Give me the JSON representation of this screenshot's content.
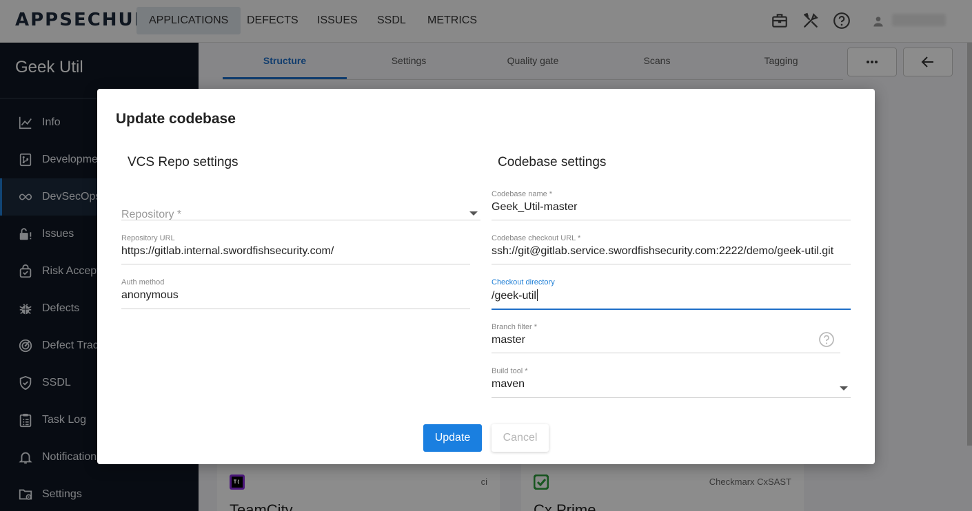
{
  "app": {
    "logo": "APPSECHUB"
  },
  "topnav": {
    "items": [
      {
        "label": "APPLICATIONS",
        "active": true
      },
      {
        "label": "DEFECTS"
      },
      {
        "label": "ISSUES"
      },
      {
        "label": "SSDL"
      },
      {
        "label": "METRICS"
      }
    ],
    "icons": [
      "toolbox-icon",
      "tools-icon",
      "help-icon",
      "user-icon"
    ]
  },
  "sidebar": {
    "title": "Geek Util",
    "items": [
      {
        "label": "Info",
        "icon": "chart-line-icon"
      },
      {
        "label": "Development",
        "icon": "repository-icon"
      },
      {
        "label": "DevSecOps",
        "icon": "infinity-icon",
        "active": true
      },
      {
        "label": "Issues",
        "icon": "lock-alert-icon"
      },
      {
        "label": "Risk Acceptance",
        "icon": "bag-check-icon"
      },
      {
        "label": "Defects",
        "icon": "bug-icon"
      },
      {
        "label": "Defect Tracking",
        "icon": "radar-icon"
      },
      {
        "label": "SSDL",
        "icon": "shield-check-icon"
      },
      {
        "label": "Task Log",
        "icon": "clipboard-list-icon"
      },
      {
        "label": "Notifications",
        "icon": "bell-icon"
      },
      {
        "label": "Settings",
        "icon": "folder-gear-icon"
      }
    ]
  },
  "tabs": [
    {
      "label": "Structure",
      "active": true
    },
    {
      "label": "Settings"
    },
    {
      "label": "Quality gate"
    },
    {
      "label": "Scans"
    },
    {
      "label": "Tagging"
    }
  ],
  "toolbar": {
    "more_icon": "more-horizontal-icon",
    "back_icon": "arrow-left-icon"
  },
  "cards": [
    {
      "title": "TeamCity",
      "subtitle": "ci",
      "icon": "teamcity-icon"
    },
    {
      "title": "Cx Prime",
      "subtitle": "Checkmarx CxSAST",
      "icon": "checkmarx-icon"
    }
  ],
  "dialog": {
    "title": "Update codebase",
    "vcs": {
      "section_title": "VCS Repo settings",
      "repository": {
        "placeholder": "Repository *",
        "value": ""
      },
      "repository_url": {
        "label": "Repository URL",
        "value": "https://gitlab.internal.swordfishsecurity.com/"
      },
      "auth_method": {
        "label": "Auth method",
        "value": "anonymous"
      }
    },
    "codebase": {
      "section_title": "Codebase settings",
      "name": {
        "label": "Codebase name *",
        "value": "Geek_Util-master"
      },
      "checkout_url": {
        "label": "Codebase checkout URL *",
        "value": "ssh://git@gitlab.service.swordfishsecurity.com:2222/demo/geek-util.git"
      },
      "checkout_directory": {
        "label": "Checkout directory",
        "value": "/geek-util",
        "focused": true
      },
      "branch_filter": {
        "label": "Branch filter *",
        "value": "master"
      },
      "build_tool": {
        "label": "Build tool *",
        "value": "maven"
      }
    },
    "buttons": {
      "update": "Update",
      "cancel": "Cancel"
    }
  },
  "colors": {
    "primary": "#1a7fe0",
    "sidebar_bg": "#0f1723",
    "active_tab": "#1f6fc8"
  }
}
